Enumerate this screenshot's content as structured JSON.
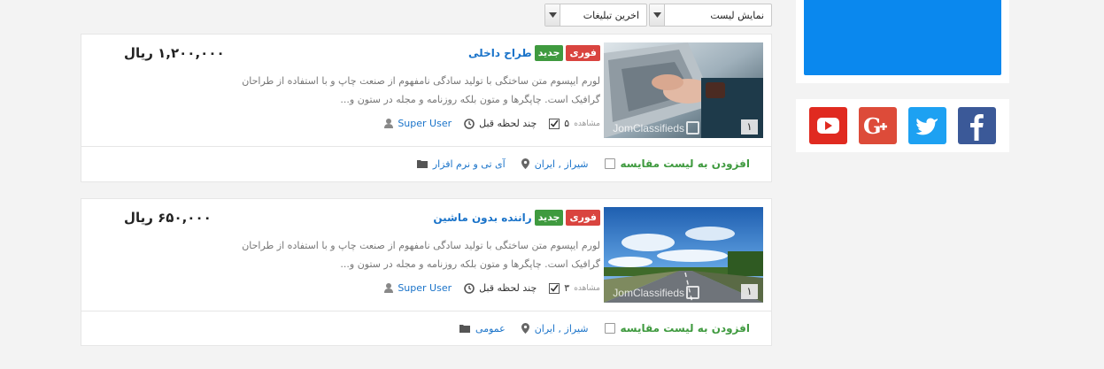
{
  "toolbar": {
    "display_select": "نمایش لیست",
    "sort_select": "اخرین تبلیغات"
  },
  "listings": [
    {
      "title": "طراح داخلی",
      "badge_new": "جدید",
      "badge_urgent": "فوری",
      "price": "۱,۲۰۰,۰۰۰ ریال",
      "description": "لورم ایپسوم متن ساختگی با تولید سادگی نامفهوم از صنعت چاپ و با استفاده از طراحان گرافیک است. چاپگرها و متون بلکه روزنامه و مجله در ستون و...",
      "user": "Super User",
      "time": "چند لحظه قبل",
      "views_count": "۵",
      "views_label": "مشاهده",
      "image_count": "۱",
      "watermark": "JomClassifieds",
      "category": "آی تی و نرم افزار",
      "location": "شیراز , ایران",
      "compare": "افزودن به لیست مقایسه"
    },
    {
      "title": "راننده بدون ماشین",
      "badge_new": "جدید",
      "badge_urgent": "فوری",
      "price": "۶۵۰,۰۰۰ ریال",
      "description": "لورم ایپسوم متن ساختگی با تولید سادگی نامفهوم از صنعت چاپ و با استفاده از طراحان گرافیک است. چاپگرها و متون بلکه روزنامه و مجله در ستون و...",
      "user": "Super User",
      "time": "چند لحظه قبل",
      "views_count": "۳",
      "views_label": "مشاهده",
      "image_count": "۱",
      "watermark": "JomClassifieds",
      "category": "عمومی",
      "location": "شیراز , ایران",
      "compare": "افزودن به لیست مقایسه"
    }
  ],
  "social": [
    {
      "name": "youtube-icon",
      "color": "#e02a20"
    },
    {
      "name": "google-plus-icon",
      "color": "#dd4b39"
    },
    {
      "name": "twitter-icon",
      "color": "#1da1f2"
    },
    {
      "name": "facebook-icon",
      "color": "#3b5998"
    }
  ],
  "colors": {
    "link": "#1a73c9",
    "badge_new": "#3f9a3f",
    "badge_urgent": "#d9443f",
    "compare": "#3f9a3f",
    "banner": "#0a88ee"
  }
}
